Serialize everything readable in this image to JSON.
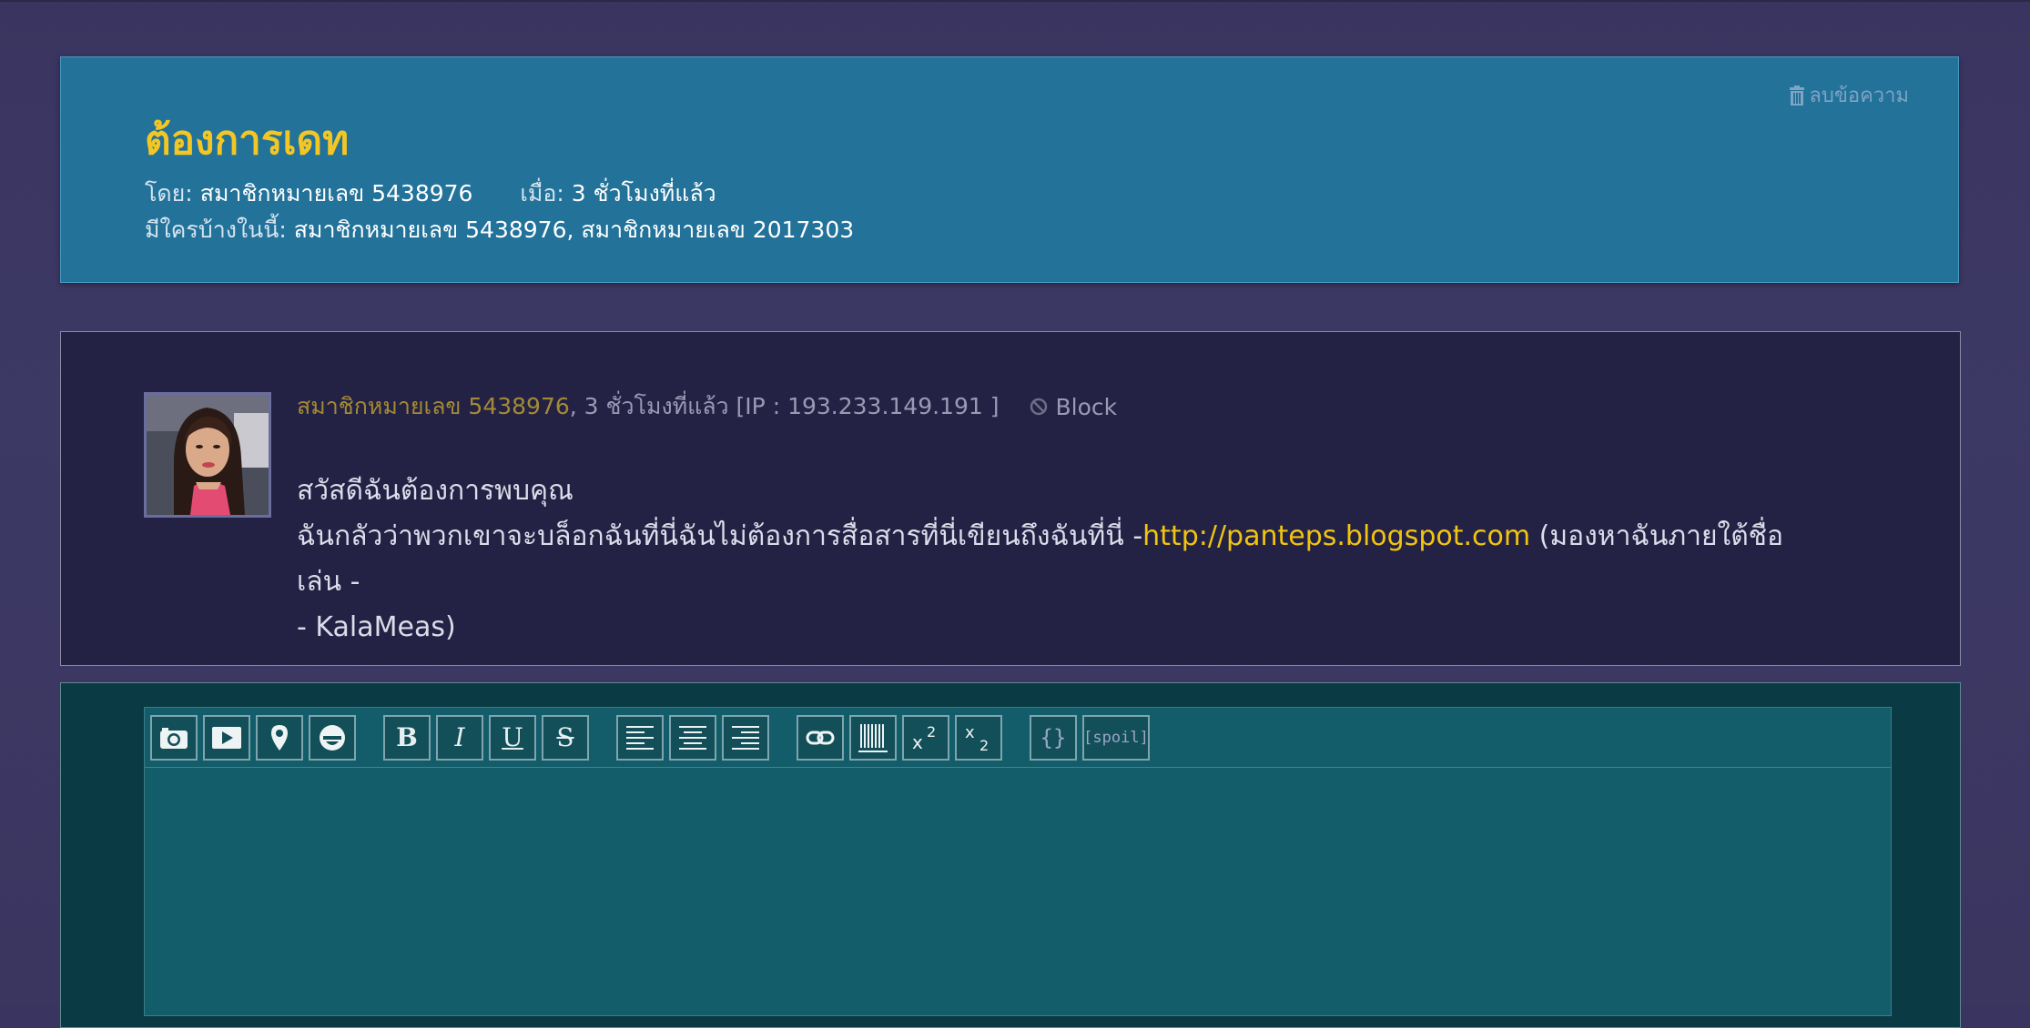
{
  "topic": {
    "title": "ต้องการเดท",
    "delete_label": "ลบข้อความ",
    "by_label": "โดย:",
    "author": "สมาชิกหมายเลข 5438976",
    "when_label": "เมื่อ:",
    "when": "3 ชั่วโมงที่แล้ว",
    "participants_label": "มีใครบ้างในนี้:",
    "participants": "สมาชิกหมายเลข 5438976, สมาชิกหมายเลข 2017303"
  },
  "post": {
    "author": "สมาชิกหมายเลข 5438976",
    "meta": ", 3 ชั่วโมงที่แล้ว [IP : 193.233.149.191 ]",
    "block_label": "Block",
    "line1": "สวัสดีฉันต้องการพบคุณ",
    "line2_before": "ฉันกลัวว่าพวกเขาจะบล็อกฉันที่นี่ฉันไม่ต้องการสื่อสารที่นี่เขียนถึงฉันที่นี่ -",
    "link": "http://panteps.blogspot.com",
    "line2_after": " (มองหาฉันภายใต้ชื่อเล่น -",
    "line3": "- KalaMeas)"
  },
  "editor": {
    "buttons": [
      "camera-icon",
      "video-icon",
      "map-pin-icon",
      "emoji-icon",
      "bold",
      "italic",
      "underline",
      "strikethrough",
      "align-left",
      "align-center",
      "align-right",
      "link-icon",
      "barcode-icon",
      "superscript",
      "subscript",
      "code",
      "spoiler"
    ],
    "bold_label": "B",
    "italic_label": "I",
    "underline_label": "U",
    "strike_label": "S",
    "code_label": "{}",
    "spoil_label": "[spoil]"
  },
  "colors": {
    "title": "#f3c623",
    "link": "#f1c40f",
    "header_bg": "#22729a",
    "post_bg": "#232244",
    "reply_bg": "#0a3a43",
    "editor_bg": "#135c69"
  }
}
